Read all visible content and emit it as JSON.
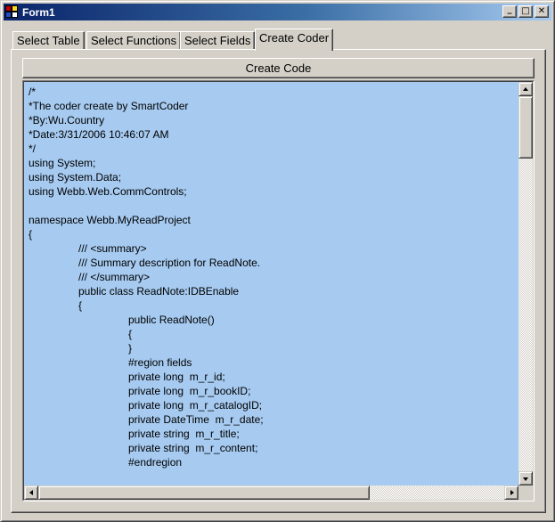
{
  "window": {
    "title": "Form1",
    "minimize_glyph": "_",
    "maximize_glyph": "□",
    "close_glyph": "✕"
  },
  "tabs": [
    {
      "label": "Select Table",
      "active": false
    },
    {
      "label": "Select Functions",
      "active": false
    },
    {
      "label": "Select Fields",
      "active": false
    },
    {
      "label": "Create Coder",
      "active": true
    }
  ],
  "create_button": {
    "label": "Create Code"
  },
  "code": {
    "lines": [
      "/*",
      "*The coder create by SmartCoder",
      "*By:Wu.Country",
      "*Date:3/31/2006 10:46:07 AM",
      "*/",
      "using System;",
      "using System.Data;",
      "using Webb.Web.CommControls;",
      "",
      "namespace Webb.MyReadProject",
      "{",
      "/// <summary>",
      "/// Summary description for ReadNote.",
      "/// </summary>",
      "public class ReadNote:IDBEnable",
      "{",
      "public ReadNote()",
      "{",
      "}",
      "#region fields",
      "private long  m_r_id;",
      "private long  m_r_bookID;",
      "private long  m_r_catalogID;",
      "private DateTime  m_r_date;",
      "private string  m_r_title;",
      "private string  m_r_content;",
      "#endregion"
    ],
    "indent_levels": [
      0,
      0,
      0,
      0,
      0,
      0,
      0,
      0,
      0,
      0,
      0,
      1,
      1,
      1,
      1,
      1,
      2,
      2,
      2,
      2,
      2,
      2,
      2,
      2,
      2,
      2,
      2
    ],
    "background_color": "#a6caf0"
  },
  "colors": {
    "title_bar_start": "#0a246a",
    "title_bar_end": "#a6caf0",
    "face": "#d4d0c8"
  }
}
